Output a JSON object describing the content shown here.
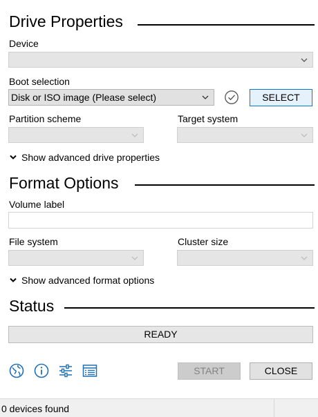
{
  "drive_properties": {
    "title": "Drive Properties",
    "device_label": "Device",
    "device_value": "",
    "boot_selection_label": "Boot selection",
    "boot_selection_value": "Disk or ISO image (Please select)",
    "select_button": "SELECT",
    "partition_scheme_label": "Partition scheme",
    "partition_scheme_value": "",
    "target_system_label": "Target system",
    "target_system_value": "",
    "advanced_toggle": "Show advanced drive properties"
  },
  "format_options": {
    "title": "Format Options",
    "volume_label_label": "Volume label",
    "volume_label_value": "",
    "file_system_label": "File system",
    "file_system_value": "",
    "cluster_size_label": "Cluster size",
    "cluster_size_value": "",
    "advanced_toggle": "Show advanced format options"
  },
  "status": {
    "title": "Status",
    "progress_text": "READY",
    "progress_fraction": 0
  },
  "toolbar": {
    "icons": [
      "language-globe-icon",
      "about-info-icon",
      "settings-sliders-icon",
      "log-list-icon"
    ],
    "start_button": "START",
    "close_button": "CLOSE"
  },
  "status_bar": {
    "text": "0 devices found"
  },
  "colors": {
    "accent": "#0078d7",
    "icon_blue": "#1f6fb4",
    "disabled_bg": "#cccccc"
  }
}
